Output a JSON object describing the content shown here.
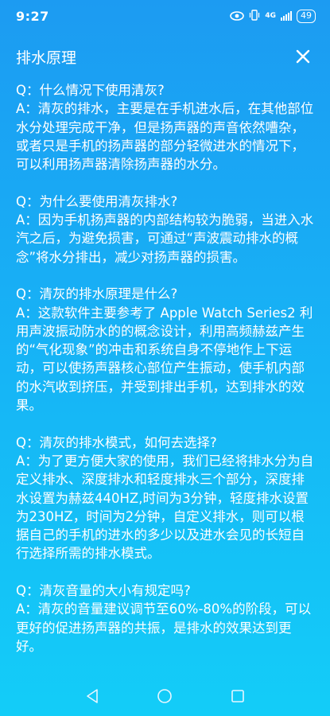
{
  "status_bar": {
    "time": "9:27",
    "network": "4G",
    "battery": "49"
  },
  "header": {
    "title": "排水原理"
  },
  "faq": [
    {
      "q": "Q：什么情况下使用清灰?",
      "a": "A：清灰的排水，主要是在手机进水后，在其他部位水分处理完成干净，但是扬声器的声音依然嘈杂，或者只是手机的扬声器的部分轻微进水的情况下，可以利用扬声器清除扬声器的水分。"
    },
    {
      "q": "Q：为什么要使用清灰排水?",
      "a": "A：因为手机扬声器的内部结构较为脆弱，当进入水汽之后，为避免损害，可通过“声波震动排水的概念”将水分排出，减少对扬声器的损害。"
    },
    {
      "q": "Q：清灰的排水原理是什么?",
      "a": "A：这款软件主要参考了 Apple Watch Series2 利用声波振动防水的的概念设计，利用高频赫兹产生的“气化现象”的冲击和系统自身不停地作上下运动，可以使扬声器核心部位产生振动，使手机内部的水汽收到挤压，并受到排出手机，达到排水的效果。"
    },
    {
      "q": "Q：清灰的排水模式，如何去选择?",
      "a": "A：为了更方便大家的使用，我们已经将排水分为自定义排水、深度排水和轻度排水三个部分，深度排水设置为赫兹440HZ,时间为3分钟，轻度排水设置为230HZ，时间为2分钟，自定义排水，则可以根据自己的手机的进水的多少以及进水会见的长短自行选择所需的排水模式。"
    },
    {
      "q": "Q：清灰音量的大小有规定吗?",
      "a": "A：清灰的音量建议调节至60%-80%的阶段，可以更好的促进扬声器的共振，是排水的效果达到更好。"
    }
  ]
}
